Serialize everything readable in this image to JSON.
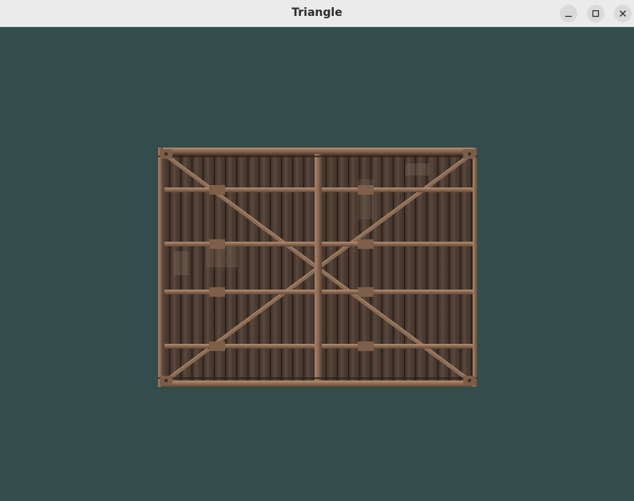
{
  "window": {
    "title": "Triangle",
    "controls": {
      "minimize_icon": "minimize-icon",
      "maximize_icon": "maximize-icon",
      "close_icon": "close-icon"
    }
  },
  "scene": {
    "clear_color": "#334c4c",
    "textured_quad": "wooden-crate-texture"
  }
}
